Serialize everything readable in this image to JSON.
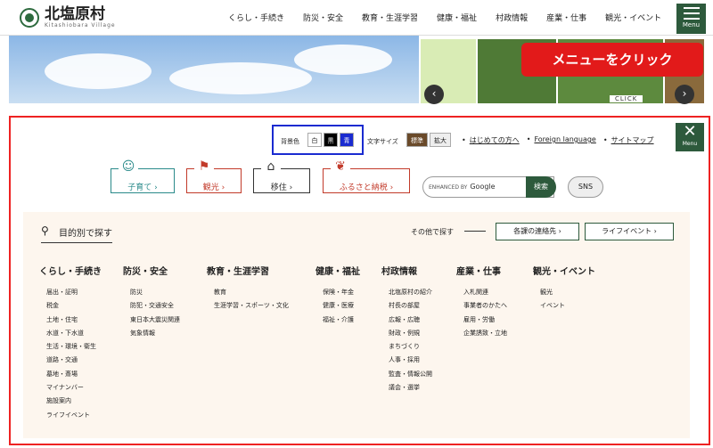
{
  "header": {
    "logo_name": "北塩原村",
    "logo_sub": "Kitashiobara Village",
    "nav": [
      "くらし・手続き",
      "防災・安全",
      "教育・生涯学習",
      "健康・福祉",
      "村政情報",
      "産業・仕事",
      "観光・イベント"
    ],
    "menu_label": "Menu"
  },
  "hero": {
    "callout": "メニューをクリック",
    "click_tag": "CLICK",
    "prev": "‹",
    "next": "›"
  },
  "menu": {
    "close_label": "Menu",
    "bg_label": "背景色",
    "bg_options": [
      "白",
      "黒",
      "青"
    ],
    "size_label": "文字サイズ",
    "size_options": [
      "標準",
      "拡大"
    ],
    "utility": [
      "はじめての方へ",
      "Foreign language",
      "サイトマップ"
    ],
    "category_buttons": [
      "子育て",
      "観光",
      "移住",
      "ふるさと納税"
    ],
    "search": {
      "enhanced": "ENHANCED BY",
      "brand": "Google",
      "button": "検索"
    },
    "sns": "SNS",
    "purpose_title": "目的別で探す",
    "other_label": "その他で探す",
    "other_links": [
      "各課の連絡先",
      "ライフイベント"
    ],
    "columns": [
      {
        "head": "くらし・手続き",
        "items": [
          "届出・証明",
          "税金",
          "土地・住宅",
          "水道・下水道",
          "生活・環境・衛生",
          "道路・交通",
          "墓地・斎場",
          "マイナンバー",
          "施設案内",
          "ライフイベント"
        ]
      },
      {
        "head": "防災・安全",
        "items": [
          "防災",
          "防犯・交通安全",
          "東日本大震災関連",
          "気象情報"
        ]
      },
      {
        "head": "教育・生涯学習",
        "items": [
          "教育",
          "生涯学習・スポーツ・文化"
        ]
      },
      {
        "head": "健康・福祉",
        "items": [
          "保険・年金",
          "健康・医療",
          "福祉・介護"
        ]
      },
      {
        "head": "村政情報",
        "items": [
          "北塩原村の紹介",
          "村長の部屋",
          "広報・広聴",
          "財政・例規",
          "まちづくり",
          "人事・採用",
          "監査・情報公開",
          "議会・選挙"
        ]
      },
      {
        "head": "産業・仕事",
        "items": [
          "入札関連",
          "事業者のかたへ",
          "雇用・労働",
          "企業誘致・立地"
        ]
      },
      {
        "head": "観光・イベント",
        "items": [
          "観光",
          "イベント"
        ]
      }
    ]
  },
  "colors": {
    "brand_green": "#2d5a3c",
    "highlight_red": "#e21a1a",
    "highlight_blue": "#1a2bd0"
  }
}
